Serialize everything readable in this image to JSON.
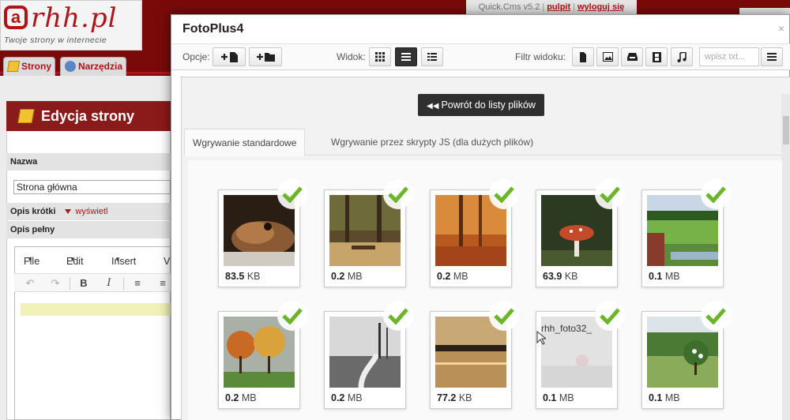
{
  "app": {
    "logo_text": "rhh.pl",
    "logo_tagline": "Twoje strony w internecie",
    "topbar": {
      "version": "Quick.Cms v5.2",
      "dashboard": "pulpit",
      "logout": "wyloguj się"
    },
    "nav": [
      {
        "label": "Strony"
      },
      {
        "label": "Narzędzia"
      }
    ],
    "edit_panel": {
      "title": "Edycja strony",
      "name_label": "Nazwa",
      "name_value": "Strona główna",
      "short_desc_label": "Opis krótki",
      "show_toggle": "wyświetl",
      "full_desc_label": "Opis pełny",
      "editor_menu": [
        "File",
        "Edit",
        "Insert",
        "V"
      ]
    }
  },
  "modal": {
    "title": "FotoPlus4",
    "close": "×",
    "options_label": "Opcje:",
    "view_label": "Widok:",
    "filter_label": "Filtr widoku:",
    "search_placeholder": "wpisz txt...",
    "back_button": "Powrót do listy plików",
    "tabs": [
      "Wgrywanie standardowe",
      "Wgrywanie przez skrypty JS (dla dużych plików)"
    ],
    "files": [
      {
        "size_value": "83.5",
        "size_unit": "KB",
        "thumb": "frog"
      },
      {
        "size_value": "0.2",
        "size_unit": "MB",
        "thumb": "forest-bench"
      },
      {
        "size_value": "0.2",
        "size_unit": "MB",
        "thumb": "autumn-forest"
      },
      {
        "size_value": "63.9",
        "size_unit": "KB",
        "thumb": "mushroom"
      },
      {
        "size_value": "0.1",
        "size_unit": "MB",
        "thumb": "green-valley"
      },
      {
        "size_value": "0.2",
        "size_unit": "MB",
        "thumb": "autumn-trees"
      },
      {
        "size_value": "0.2",
        "size_unit": "MB",
        "thumb": "bw-path"
      },
      {
        "size_value": "77.2",
        "size_unit": "KB",
        "thumb": "sunset-lake"
      },
      {
        "size_value": "0.1",
        "size_unit": "MB",
        "thumb": "uploading",
        "filename": "rhh_foto32_"
      },
      {
        "size_value": "0.1",
        "size_unit": "MB",
        "thumb": "tree-meadow"
      }
    ]
  },
  "colors": {
    "brand": "#b0141b",
    "header_bg": "#7a0a0a",
    "check": "#6cb52b"
  }
}
